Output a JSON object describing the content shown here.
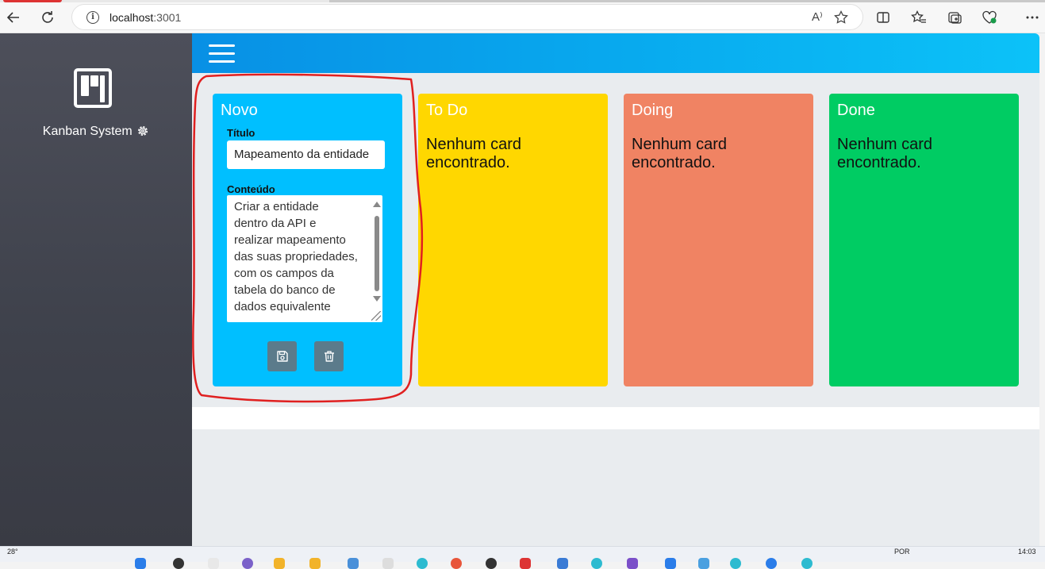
{
  "browser": {
    "url_host": "localhost",
    "url_port": ":3001",
    "read_aloud_label": "A⁾"
  },
  "sidebar": {
    "brand": "Kanban System"
  },
  "columns": [
    {
      "title": "Novo",
      "color": "#00bfff",
      "form": {
        "titulo_label": "Título",
        "titulo_value": "Mapeamento da entidade",
        "conteudo_label": "Conteúdo",
        "conteudo_value": "Criar a entidade\ndentro da API e\nrealizar mapeamento\ndas suas propriedades,\ncom os campos da\ntabela do banco de\ndados equivalente"
      }
    },
    {
      "title": "To Do",
      "color": "#ffd700",
      "empty_text": "Nenhum card encontrado."
    },
    {
      "title": "Doing",
      "color": "#f08363",
      "empty_text": "Nenhum card encontrado."
    },
    {
      "title": "Done",
      "color": "#00cc63",
      "empty_text": "Nenhum card encontrado."
    }
  ],
  "taskbar": {
    "temperature": "28°",
    "language": "POR",
    "time": "14:03"
  },
  "colors": {
    "topbar": "#0aa5ee",
    "sidebar": "#444650",
    "card_action": "#5b7b8b",
    "annotation": "#e02020"
  },
  "icons": {
    "save": "floppy-disk-icon",
    "delete": "trash-icon",
    "menu": "hamburger-icon",
    "settings": "gear-icon"
  }
}
